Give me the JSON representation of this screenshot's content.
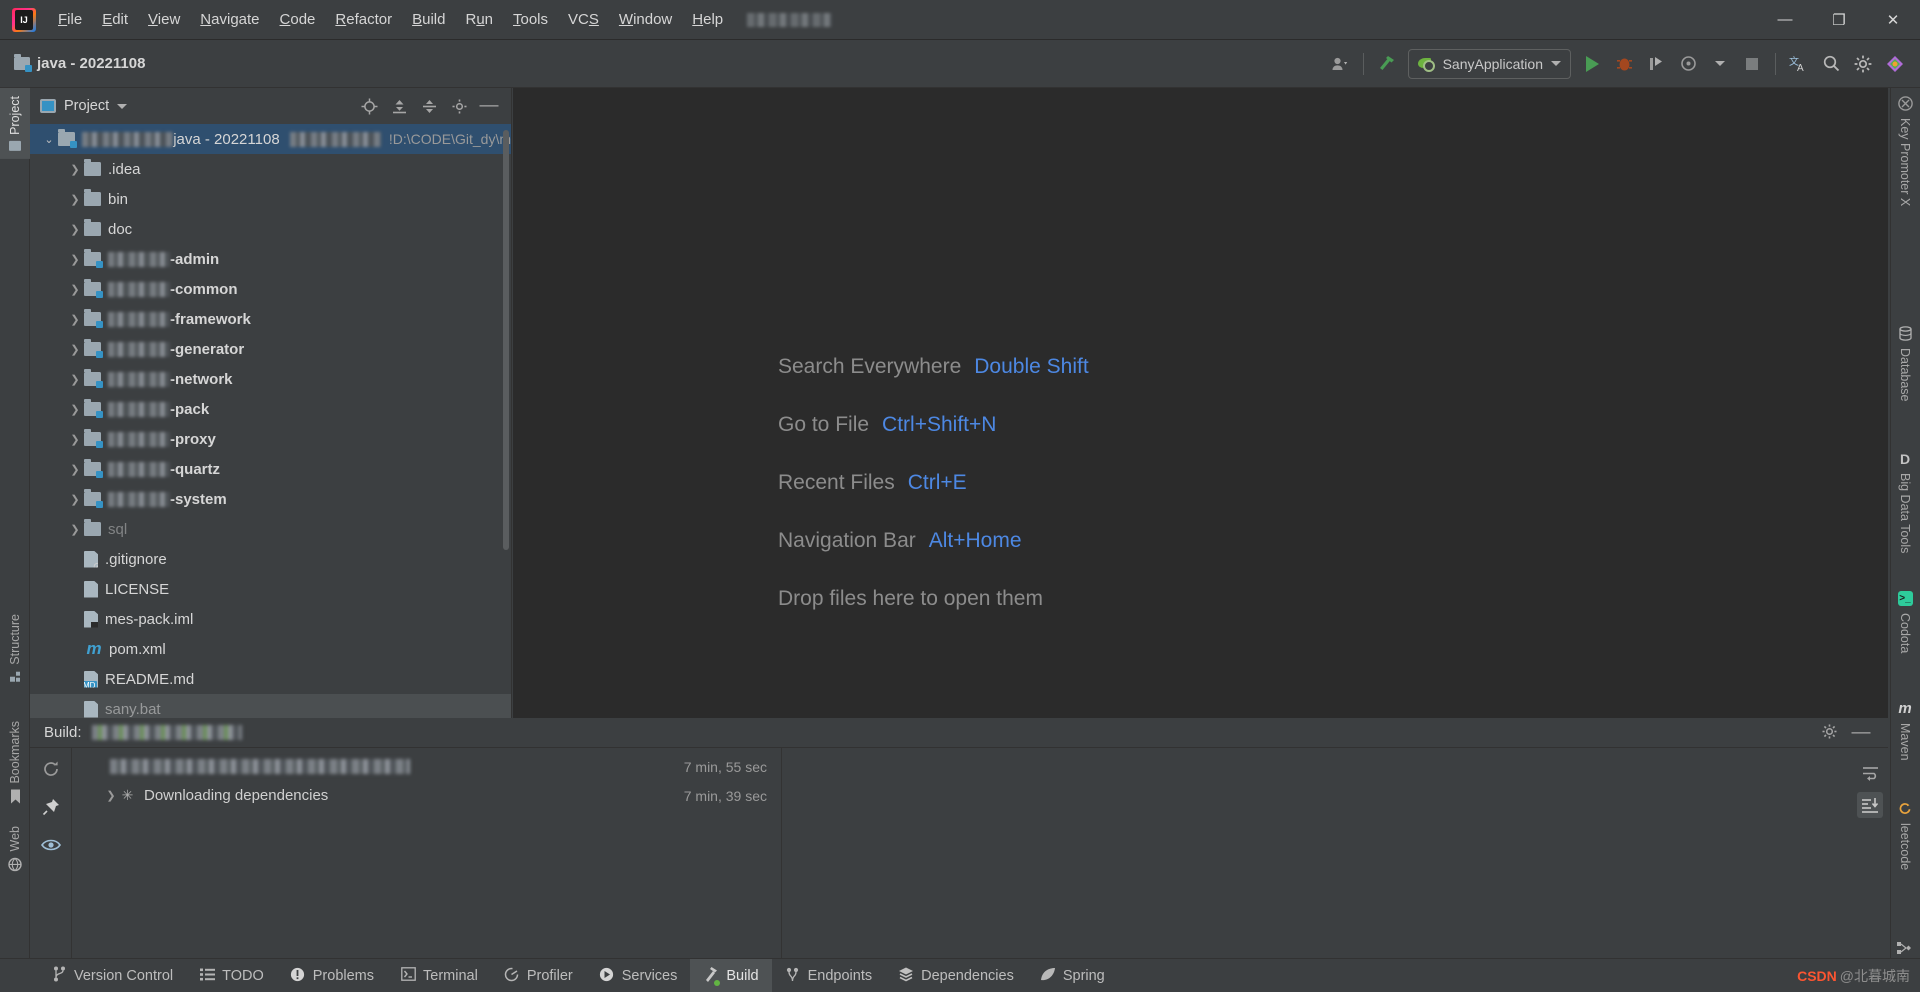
{
  "window": {
    "app_icon": "intellij-logo",
    "menu": [
      {
        "label": "File",
        "mnemonic": "F"
      },
      {
        "label": "Edit",
        "mnemonic": "E"
      },
      {
        "label": "View",
        "mnemonic": "V"
      },
      {
        "label": "Navigate",
        "mnemonic": "N"
      },
      {
        "label": "Code",
        "mnemonic": "C"
      },
      {
        "label": "Refactor",
        "mnemonic": "R"
      },
      {
        "label": "Build",
        "mnemonic": "B"
      },
      {
        "label": "Run",
        "mnemonic": "u"
      },
      {
        "label": "Tools",
        "mnemonic": "T"
      },
      {
        "label": "VCS",
        "mnemonic": "S"
      },
      {
        "label": "Window",
        "mnemonic": "W"
      },
      {
        "label": "Help",
        "mnemonic": "H"
      }
    ],
    "controls": {
      "minimize": "—",
      "maximize": "❐",
      "close": "✕"
    }
  },
  "toolbar": {
    "project_label": "java - 20221108",
    "run_config": "SanyApplication",
    "icons": [
      "account-icon",
      "build-hammer-icon",
      "run-icon",
      "debug-icon",
      "run-coverage-icon",
      "profiler-icon",
      "stop-icon",
      "translate-icon",
      "search-icon",
      "settings-icon",
      "plugin-icon"
    ]
  },
  "left_stripe": {
    "tabs": [
      {
        "label": "Project",
        "icon": "folder-icon",
        "active": true
      },
      {
        "label": "Structure",
        "icon": "structure-icon",
        "active": false
      },
      {
        "label": "Bookmarks",
        "icon": "bookmark-icon",
        "active": false
      },
      {
        "label": "Web",
        "icon": "web-icon",
        "active": false
      }
    ]
  },
  "project_panel": {
    "title": "Project",
    "header_icons": [
      "select-opened-file-icon",
      "expand-all-icon",
      "collapse-all-icon",
      "settings-icon",
      "hide-icon"
    ],
    "tree": [
      {
        "indent": 0,
        "arrow": "open",
        "icon": "module-folder",
        "label": "java - 20221108",
        "blur": 105,
        "path": "!D:\\CODE\\Git_dy\\m",
        "selected": true
      },
      {
        "indent": 1,
        "arrow": "closed",
        "icon": "folder",
        "label": ".idea"
      },
      {
        "indent": 1,
        "arrow": "closed",
        "icon": "folder",
        "label": "bin"
      },
      {
        "indent": 1,
        "arrow": "closed",
        "icon": "folder",
        "label": "doc"
      },
      {
        "indent": 1,
        "arrow": "closed",
        "icon": "module",
        "blur": 62,
        "label": "-admin",
        "bold": true
      },
      {
        "indent": 1,
        "arrow": "closed",
        "icon": "module",
        "blur": 62,
        "label": "-common",
        "bold": true
      },
      {
        "indent": 1,
        "arrow": "closed",
        "icon": "module",
        "blur": 62,
        "label": "-framework",
        "bold": true
      },
      {
        "indent": 1,
        "arrow": "closed",
        "icon": "module",
        "blur": 62,
        "label": "-generator",
        "bold": true
      },
      {
        "indent": 1,
        "arrow": "closed",
        "icon": "module",
        "blur": 62,
        "label": "-network",
        "bold": true
      },
      {
        "indent": 1,
        "arrow": "closed",
        "icon": "module",
        "blur": 62,
        "label": "-pack",
        "bold": true
      },
      {
        "indent": 1,
        "arrow": "closed",
        "icon": "module",
        "blur": 62,
        "label": "-proxy",
        "bold": true
      },
      {
        "indent": 1,
        "arrow": "closed",
        "icon": "module",
        "blur": 62,
        "label": "-quartz",
        "bold": true
      },
      {
        "indent": 1,
        "arrow": "closed",
        "icon": "module",
        "blur": 62,
        "label": "-system",
        "bold": true
      },
      {
        "indent": 1,
        "arrow": "closed",
        "icon": "folder",
        "label": "sql",
        "dim": true
      },
      {
        "indent": 1,
        "arrow": "none",
        "icon": "gitignore-file",
        "label": ".gitignore"
      },
      {
        "indent": 1,
        "arrow": "none",
        "icon": "text-file",
        "label": "LICENSE"
      },
      {
        "indent": 1,
        "arrow": "none",
        "icon": "iml-file",
        "label": "mes-pack.iml"
      },
      {
        "indent": 1,
        "arrow": "none",
        "icon": "maven-file",
        "label": "pom.xml"
      },
      {
        "indent": 1,
        "arrow": "none",
        "icon": "markdown-file",
        "label": "README.md"
      },
      {
        "indent": 1,
        "arrow": "none",
        "icon": "bat-file",
        "label": "sany.bat",
        "partial": true
      }
    ]
  },
  "editor": {
    "hints": [
      {
        "label": "Search Everywhere",
        "key": "Double Shift"
      },
      {
        "label": "Go to File",
        "key": "Ctrl+Shift+N"
      },
      {
        "label": "Recent Files",
        "key": "Ctrl+E"
      },
      {
        "label": "Navigation Bar",
        "key": "Alt+Home"
      },
      {
        "label": "Drop files here to open them",
        "key": ""
      }
    ]
  },
  "build_panel": {
    "title": "Build:",
    "header_icons": [
      "settings-icon",
      "minimize-icon"
    ],
    "side_icons": [
      "rerun-icon",
      "pin-icon",
      "eye-icon"
    ],
    "rows": [
      {
        "blur": true,
        "label": "",
        "time": "7 min, 55 sec",
        "arrow": "none"
      },
      {
        "blur": false,
        "label": "Downloading dependencies",
        "time": "7 min, 39 sec",
        "arrow": "closed",
        "icon": "spinner-icon"
      }
    ],
    "console_icons": [
      "soft-wrap-icon",
      "scroll-to-end-icon"
    ]
  },
  "right_stripe": {
    "tabs": [
      {
        "label": "Key Promoter X",
        "icon": "key-promoter-icon",
        "color": "#9a9a9a"
      },
      {
        "label": "Database",
        "icon": "database-icon",
        "color": "#b0b0b0"
      },
      {
        "label": "Big Data Tools",
        "icon": "bigdata-icon",
        "color": "#c0c0c0"
      },
      {
        "label": "Codota",
        "icon": "codota-icon",
        "color": "#2ecb9b"
      },
      {
        "label": "Maven",
        "icon": "maven-icon",
        "color": "#c0c0c0"
      },
      {
        "label": "leetcode",
        "icon": "leetcode-icon",
        "color": "#e8a33d"
      },
      {
        "label": "",
        "icon": "endpoints-icon",
        "color": "#b0b0b0"
      }
    ]
  },
  "status_tabs": [
    {
      "label": "Version Control",
      "icon": "branch-icon",
      "active": false
    },
    {
      "label": "TODO",
      "icon": "list-icon",
      "active": false
    },
    {
      "label": "Problems",
      "icon": "warning-icon",
      "active": false
    },
    {
      "label": "Terminal",
      "icon": "terminal-icon",
      "active": false
    },
    {
      "label": "Profiler",
      "icon": "profiler-icon",
      "active": false
    },
    {
      "label": "Services",
      "icon": "services-icon",
      "active": false
    },
    {
      "label": "Build",
      "icon": "hammer-icon",
      "active": true
    },
    {
      "label": "Endpoints",
      "icon": "endpoints-icon",
      "active": false
    },
    {
      "label": "Dependencies",
      "icon": "layers-icon",
      "active": false
    },
    {
      "label": "Spring",
      "icon": "spring-leaf-icon",
      "active": false
    }
  ],
  "watermark": {
    "brand": "CSDN",
    "suffix": "@北暮城南"
  },
  "colors": {
    "bg": "#3c3f41",
    "editor_bg": "#2b2b2b",
    "accent_blue": "#4d88e3",
    "selection": "#2f4f6f",
    "green": "#499c54",
    "text": "#d6d6d6",
    "dim": "#9a9a9a"
  }
}
